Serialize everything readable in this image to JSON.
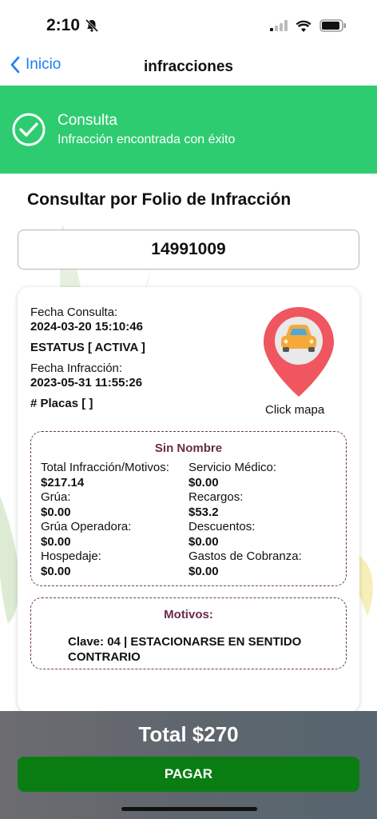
{
  "status_bar": {
    "time": "2:10",
    "icons": [
      "bell-off-icon",
      "signal-icon",
      "wifi-icon",
      "battery-icon"
    ]
  },
  "nav": {
    "back_label": "Inicio",
    "title": "infracciones"
  },
  "banner": {
    "title": "Consulta",
    "subtitle": "Infracción encontrada con éxito",
    "color": "#2ecc71"
  },
  "search": {
    "title": "Consultar por Folio de Infracción",
    "folio": "14991009"
  },
  "details": {
    "fecha_consulta_label": "Fecha Consulta:",
    "fecha_consulta": "2024-03-20 15:10:46",
    "estatus": "ESTATUS [ ACTIVA ]",
    "fecha_infraccion_label": "Fecha Infracción:",
    "fecha_infraccion": "2023-05-31 11:55:26",
    "placas": "# Placas [  ]",
    "map_caption": "Click mapa"
  },
  "summary": {
    "title": "Sin Nombre",
    "items": [
      {
        "label": "Total Infracción/Motivos:",
        "value": "$217.14"
      },
      {
        "label": "Servicio Médico:",
        "value": "$0.00"
      },
      {
        "label": "Grúa:",
        "value": "$0.00"
      },
      {
        "label": "Recargos:",
        "value": "$53.2"
      },
      {
        "label": "Grúa Operadora:",
        "value": "$0.00"
      },
      {
        "label": "Descuentos:",
        "value": "$0.00"
      },
      {
        "label": "Hospedaje:",
        "value": "$0.00"
      },
      {
        "label": "Gastos de Cobranza:",
        "value": "$0.00"
      }
    ]
  },
  "motivos": {
    "title": "Motivos:",
    "text": "Clave: 04 | ESTACIONARSE EN SENTIDO CONTRARIO"
  },
  "footer": {
    "total": "Total $270",
    "pay_label": "PAGAR",
    "pay_color": "#0a7d12"
  }
}
